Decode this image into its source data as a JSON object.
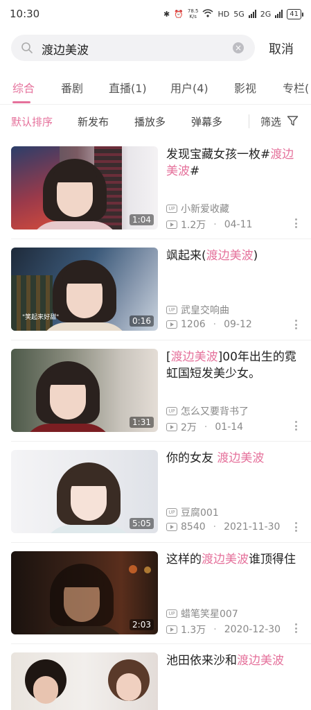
{
  "status_bar": {
    "time": "10:30",
    "net_speed_value": "78.5",
    "net_speed_unit": "K/s",
    "network_1": "5G",
    "network_2": "2G",
    "hd_label": "HD",
    "battery": "41"
  },
  "search": {
    "query": "渡边美波",
    "cancel_label": "取消"
  },
  "tabs": [
    {
      "label": "综合",
      "active": true
    },
    {
      "label": "番剧",
      "active": false
    },
    {
      "label": "直播(1)",
      "active": false
    },
    {
      "label": "用户(4)",
      "active": false
    },
    {
      "label": "影视",
      "active": false
    },
    {
      "label": "专栏(",
      "active": false
    }
  ],
  "filters": {
    "sort_default": "默认排序",
    "sort_new": "新发布",
    "sort_plays": "播放多",
    "sort_danmaku": "弹幕多",
    "filter_label": "筛选"
  },
  "accent_color": "#e5719b",
  "results": [
    {
      "title_pre": "发现宝藏女孩一枚#",
      "title_hl": "渡边美波",
      "title_post": "#",
      "uploader": "小新爱收藏",
      "plays": "1.2万",
      "date": "04-11",
      "duration": "1:04",
      "caption": ""
    },
    {
      "title_pre": "飒起来(",
      "title_hl": "渡边美波",
      "title_post": ")",
      "uploader": "武皇交响曲",
      "plays": "1206",
      "date": "09-12",
      "duration": "0:16",
      "caption": "\"笑起来好甜\""
    },
    {
      "title_pre": "[",
      "title_hl": "渡边美波",
      "title_post": "]00年出生的霓虹国短发美少女。",
      "uploader": "怎么又要背书了",
      "plays": "2万",
      "date": "01-14",
      "duration": "1:31",
      "caption": ""
    },
    {
      "title_pre": "你的女友 ",
      "title_hl": "渡边美波",
      "title_post": "",
      "uploader": "豆腐001",
      "plays": "8540",
      "date": "2021-11-30",
      "duration": "5:05",
      "caption": ""
    },
    {
      "title_pre": "这样的",
      "title_hl": "渡边美波",
      "title_post": "谁顶得住",
      "uploader": "蜡笔笑星007",
      "plays": "1.3万",
      "date": "2020-12-30",
      "duration": "2:03",
      "caption": ""
    },
    {
      "title_pre": "池田依来沙和",
      "title_hl": "渡边美波",
      "title_post": "",
      "uploader": "",
      "plays": "",
      "date": "",
      "duration": "",
      "caption": ""
    }
  ]
}
